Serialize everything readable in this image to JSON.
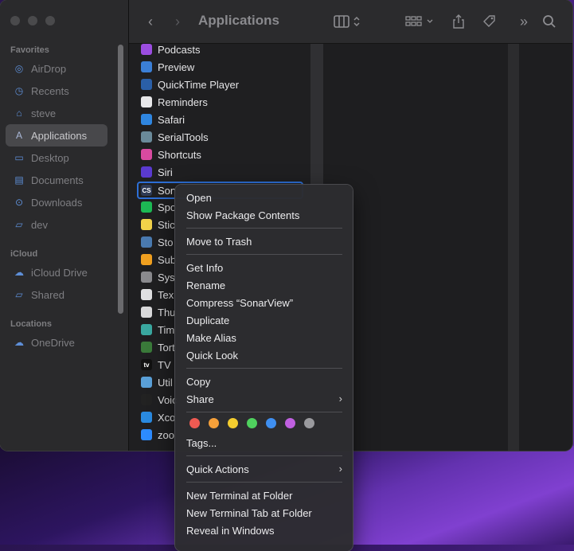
{
  "finder": {
    "title": "Applications",
    "sidebar": {
      "sections": {
        "favorites": "Favorites",
        "icloud": "iCloud",
        "locations": "Locations"
      },
      "favorites": [
        {
          "label": "AirDrop",
          "icon": "airdrop-icon"
        },
        {
          "label": "Recents",
          "icon": "clock-icon"
        },
        {
          "label": "steve",
          "icon": "home-icon"
        },
        {
          "label": "Applications",
          "icon": "applications-icon",
          "selected": true
        },
        {
          "label": "Desktop",
          "icon": "desktop-icon"
        },
        {
          "label": "Documents",
          "icon": "document-icon"
        },
        {
          "label": "Downloads",
          "icon": "downloads-icon"
        },
        {
          "label": "dev",
          "icon": "folder-icon"
        }
      ],
      "icloud": [
        {
          "label": "iCloud Drive",
          "icon": "cloud-icon"
        },
        {
          "label": "Shared",
          "icon": "shared-folder-icon"
        }
      ],
      "locations": [
        {
          "label": "OneDrive",
          "icon": "cloud-icon"
        }
      ]
    },
    "files": [
      {
        "name": "Podcasts",
        "color": "#9b4de0"
      },
      {
        "name": "Preview",
        "color": "#3b7fd6"
      },
      {
        "name": "QuickTime Player",
        "color": "#2a5fa8"
      },
      {
        "name": "Reminders",
        "color": "#e8e8ea"
      },
      {
        "name": "Safari",
        "color": "#2f86e0"
      },
      {
        "name": "SerialTools",
        "color": "#6a8a9a"
      },
      {
        "name": "Shortcuts",
        "color": "#d94aa0"
      },
      {
        "name": "Siri",
        "color": "#5a3ad0"
      },
      {
        "name": "Son",
        "color": "#2e3a55",
        "selected": true,
        "glyph": "CS"
      },
      {
        "name": "Spo",
        "color": "#1db954"
      },
      {
        "name": "Stic",
        "color": "#f2d24a"
      },
      {
        "name": "Sto",
        "color": "#4a7ab0"
      },
      {
        "name": "Sub",
        "color": "#f0a020"
      },
      {
        "name": "Sys",
        "color": "#8a8a8e"
      },
      {
        "name": "Tex",
        "color": "#e0e0e2"
      },
      {
        "name": "Thu",
        "color": "#d9d9db"
      },
      {
        "name": "Tim",
        "color": "#3aa8a0"
      },
      {
        "name": "Tort",
        "color": "#3a7a3a"
      },
      {
        "name": "TV",
        "color": "#111111",
        "glyph": "tv"
      },
      {
        "name": "Util",
        "color": "#5aa0d8"
      },
      {
        "name": "Voic",
        "color": "#222222"
      },
      {
        "name": "Xco",
        "color": "#2a8ae0"
      },
      {
        "name": "zoo",
        "color": "#2d8cff"
      }
    ]
  },
  "context_menu": {
    "items": [
      {
        "label": "Open"
      },
      {
        "label": "Show Package Contents"
      },
      {
        "separator": true
      },
      {
        "label": "Move to Trash"
      },
      {
        "separator": true
      },
      {
        "label": "Get Info"
      },
      {
        "label": "Rename"
      },
      {
        "label": "Compress “SonarView”"
      },
      {
        "label": "Duplicate"
      },
      {
        "label": "Make Alias"
      },
      {
        "label": "Quick Look"
      },
      {
        "separator": true
      },
      {
        "label": "Copy"
      },
      {
        "label": "Share",
        "submenu": true
      },
      {
        "separator": true
      },
      {
        "label": "Tags..."
      },
      {
        "separator": true
      },
      {
        "label": "Quick Actions",
        "submenu": true
      },
      {
        "separator": true
      },
      {
        "label": "New Terminal at Folder"
      },
      {
        "label": "New Terminal Tab at Folder"
      },
      {
        "label": "Reveal in Windows"
      }
    ],
    "tag_colors": [
      "#ee5a52",
      "#f5a03a",
      "#f4cd2f",
      "#4fd15e",
      "#3f8ff0",
      "#c060e0",
      "#9a9a9e"
    ]
  }
}
